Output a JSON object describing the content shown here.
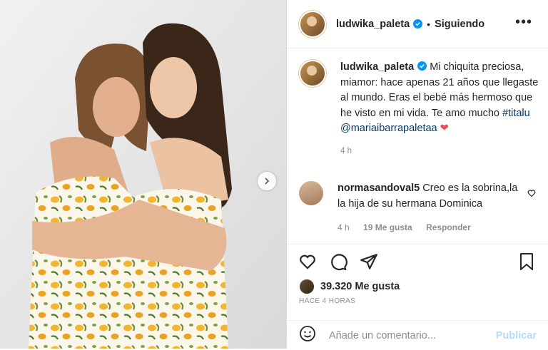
{
  "post": {
    "username": "ludwika_paleta",
    "follow_label": "Siguiendo",
    "separator": "•",
    "more_label": "•••"
  },
  "caption": {
    "username": "ludwika_paleta",
    "text": "Mi chiquita preciosa, miamor: hace apenas 21 años que llegaste al mundo. Eras el bebé más hermoso que he visto en mi vida. Te amo mucho",
    "hashtag": "#titalu",
    "mention": "@mariaibarrapaletaa",
    "emoji": "❤",
    "time": "4 h"
  },
  "comment": {
    "username": "normasandoval5",
    "text": "Creo es la sobrina,la la hija de su hermana Dominica",
    "time": "4 h",
    "likes": "19 Me gusta",
    "reply": "Responder"
  },
  "stats": {
    "likes": "39.320 Me gusta",
    "ago": "HACE 4 HORAS"
  },
  "composer": {
    "placeholder": "Añade un comentario...",
    "publish": "Publicar"
  },
  "icons": [
    "heart-icon",
    "comment-icon",
    "share-icon",
    "save-icon",
    "emoji-icon",
    "chevron-right-icon",
    "verified-icon",
    "more-icon"
  ],
  "colors": {
    "link": "#00376b",
    "verified": "#0095f6",
    "publish_disabled": "#b3dbff",
    "muted": "#8e8e8e"
  }
}
